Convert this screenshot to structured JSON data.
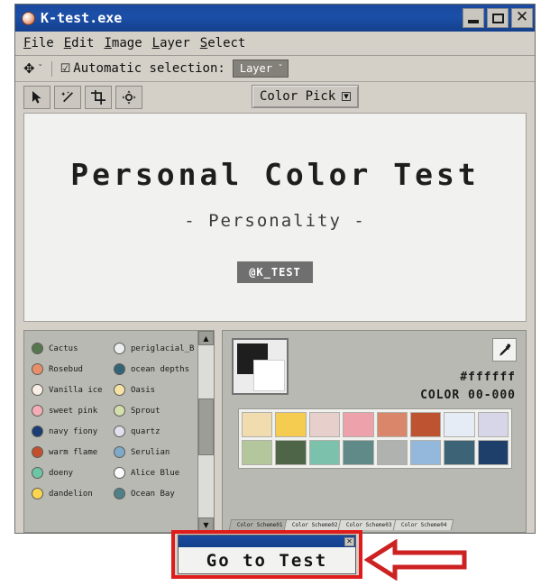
{
  "window": {
    "title": "K-test.exe",
    "icon": "app-icon",
    "buttons": {
      "minimize": "–",
      "maximize": "□",
      "close": "✕"
    }
  },
  "menubar": {
    "items": [
      {
        "mnemonic": "F",
        "rest": "ile"
      },
      {
        "mnemonic": "E",
        "rest": "dit"
      },
      {
        "mnemonic": "I",
        "rest": "mage"
      },
      {
        "mnemonic": "L",
        "rest": "ayer"
      },
      {
        "mnemonic": "S",
        "rest": "elect"
      }
    ]
  },
  "options_bar": {
    "move_tool_caret": "ˇ",
    "checkbox_glyph": "☑",
    "automatic_selection_label": "Automatic selection:",
    "layer_select_value": "Layer",
    "layer_select_caret": "ˇ"
  },
  "toolstrip": {
    "tools": [
      {
        "name": "arrow-select-tool"
      },
      {
        "name": "magic-wand-tool"
      },
      {
        "name": "crop-tool"
      },
      {
        "name": "move-target-tool"
      }
    ],
    "color_pick_label": "Color Pick",
    "color_pick_caret": "▾"
  },
  "canvas": {
    "title": "Personal Color Test",
    "subtitle": "- Personality -",
    "badge": "@K_TEST"
  },
  "color_list": {
    "items": [
      {
        "label": "Cactus",
        "color": "#55764f"
      },
      {
        "label": "periglacial_B",
        "color": "#edeef0"
      },
      {
        "label": "Rosebud",
        "color": "#e98e6a"
      },
      {
        "label": "ocean depths",
        "color": "#336377"
      },
      {
        "label": "Vanilla ice",
        "color": "#fbeee6"
      },
      {
        "label": "Oasis",
        "color": "#f6e2a4"
      },
      {
        "label": "sweet pink",
        "color": "#f4adb6"
      },
      {
        "label": "Sprout",
        "color": "#d3dfac"
      },
      {
        "label": "navy fiony",
        "color": "#1b3c74"
      },
      {
        "label": "quartz",
        "color": "#e2e0ef"
      },
      {
        "label": "warm flame",
        "color": "#c2502e"
      },
      {
        "label": "Serulian",
        "color": "#7fa9c9"
      },
      {
        "label": "doeny",
        "color": "#6ec5a6"
      },
      {
        "label": "Alice Blue",
        "color": "#fbfcfd"
      },
      {
        "label": "dandelion",
        "color": "#fbd64f"
      },
      {
        "label": "Ocean Bay",
        "color": "#4f8087"
      }
    ]
  },
  "picker": {
    "foreground": "#1e1e1e",
    "background": "#ffffff",
    "eyedropper_icon": "eyedropper-icon",
    "hex_value": "#ffffff",
    "color_code": "COLOR 00-000",
    "palette_rows": [
      [
        "#f0dcae",
        "#f5cb50",
        "#e7cfcb",
        "#eda2ab",
        "#d9866a",
        "#bd5330",
        "#e6ecf6",
        "#d7d5e8"
      ],
      [
        "#b4c79c",
        "#4e6547",
        "#7bc1ab",
        "#5f8a87",
        "#b0b2b0",
        "#94b8db",
        "#3c6376",
        "#1f3f6b"
      ]
    ],
    "tabs": [
      {
        "label": "Color Scheme01",
        "active": true
      },
      {
        "label": "Color Scheme02",
        "active": false
      },
      {
        "label": "Color Scheme03",
        "active": false
      },
      {
        "label": "Color Scheme04",
        "active": false
      }
    ]
  },
  "dialog": {
    "button_label": "Go to Test",
    "close_glyph": "✕",
    "highlight_color": "#e01b1b",
    "arrow_color": "#cc2222"
  }
}
